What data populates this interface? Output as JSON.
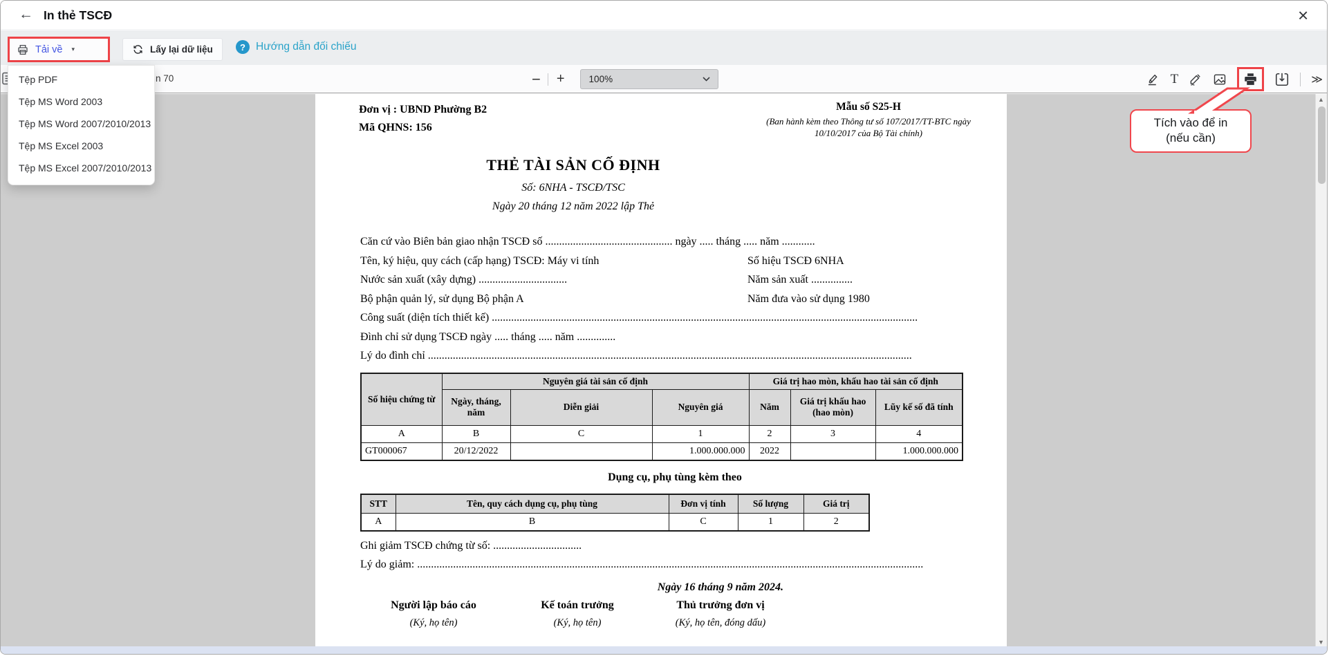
{
  "window": {
    "title": "In thẻ TSCĐ",
    "back_glyph": "←",
    "close_glyph": "×"
  },
  "action_toolbar": {
    "download_button": {
      "label": "Tải về",
      "caret": "▾"
    },
    "refresh_button": {
      "label": "Lấy lại dữ liệu"
    },
    "guide_link": {
      "label": "Hướng dẫn đối chiếu",
      "icon_glyph": "?"
    }
  },
  "download_menu": {
    "items": [
      "Tệp PDF",
      "Tệp MS Word 2003",
      "Tệp MS Word 2007/2010/2013",
      "Tệp MS Excel 2003",
      "Tệp MS Excel 2007/2010/2013"
    ]
  },
  "viewer_toolbar": {
    "left_fragment": "n 70",
    "zoom_out": "−",
    "zoom_in": "+",
    "zoom_value": "100%",
    "text_tool": "T",
    "more_glyph": "≫"
  },
  "scrollbar": {
    "up_glyph": "▲",
    "down_glyph": "▼"
  },
  "callout": {
    "line1": "Tích vào để in",
    "line2": "(nếu cần)"
  },
  "colors": {
    "accent_blue": "#4355e2",
    "link_teal": "#2aa3c9",
    "highlight_red": "#ee4348",
    "table_header_bg": "#d9d9d9",
    "viewer_bg": "#cdcdcd"
  },
  "document": {
    "unit_line": "Đơn vị : UBND Phường B2",
    "code_line": "Mã QHNS: 156",
    "form_number": "Mẫu số S25-H",
    "issued_line1": "(Ban hành kèm theo Thông tư số 107/2017/TT-BTC ngày",
    "issued_line2": "10/10/2017 của Bộ Tài chính)",
    "title": "THẺ TÀI SẢN CỐ ĐỊNH",
    "doc_number": "Số: 6NHA - TSCĐ/TSC",
    "created_date_line": "Ngày 20 tháng 12 năm 2022 lập Thẻ",
    "line_handover": "Căn cứ vào Biên bản giao nhận TSCĐ số .............................................. ngày ..... tháng ..... năm ............",
    "line_name_left": "Tên, ký hiệu, quy cách (cấp hạng) TSCĐ:  Máy vi tính",
    "line_name_right": "Số hiệu TSCĐ 6NHA",
    "line_country_left": "Nước sản xuất (xây dựng)  ................................",
    "line_country_right": "Năm sản xuất  ...............",
    "line_dept_left": "Bộ phận quản lý, sử dụng  Bộ phận A",
    "line_dept_right": "Năm đưa vào sử dụng  1980",
    "line_capacity": "Công suất (diện tích thiết kế) ..........................................................................................................................................................",
    "line_suspend": "Đình chỉ sử dụng TSCĐ ngày ..... tháng ..... năm ..............",
    "line_suspend_reason": "Lý do đình chỉ ...............................................................................................................................................................................",
    "main_table": {
      "col_doc_no": "Số hiệu chứng từ",
      "group_cost": "Nguyên giá tài sản cố định",
      "col_date": "Ngày, tháng, năm",
      "col_desc": "Diễn giải",
      "col_cost": "Nguyên giá",
      "group_dep": "Giá trị hao mòn, khấu hao tài sản cố định",
      "col_year": "Năm",
      "col_dep_value": "Giá trị khấu hao (hao mòn)",
      "col_dep_accum": "Lũy kế số đã tính",
      "letter_row": [
        "A",
        "B",
        "C",
        "1",
        "2",
        "3",
        "4"
      ],
      "data_row": [
        "GT000067",
        "20/12/2022",
        "",
        "1.000.000.000",
        "2022",
        "",
        "1.000.000.000"
      ]
    },
    "accessories": {
      "heading": "Dụng cụ, phụ tùng kèm theo",
      "headers": [
        "STT",
        "Tên, quy cách dụng cụ, phụ tùng",
        "Đơn vị tính",
        "Số lượng",
        "Giá trị"
      ],
      "letter_row": [
        "A",
        "B",
        "C",
        "1",
        "2"
      ]
    },
    "line_decrease": "Ghi giảm TSCĐ chứng từ số: ................................",
    "line_decrease_reason": "Lý do giảm: .......................................................................................................................................................................................",
    "sign_date_line": "Ngày 16 tháng 9 năm 2024.",
    "signatures": [
      {
        "title": "Người lập báo cáo",
        "note": "(Ký, họ tên)"
      },
      {
        "title": "Kế toán trưởng",
        "note": "(Ký, họ tên)"
      },
      {
        "title": "Thủ trưởng đơn vị",
        "note": "(Ký, họ tên, đóng dấu)"
      }
    ]
  }
}
